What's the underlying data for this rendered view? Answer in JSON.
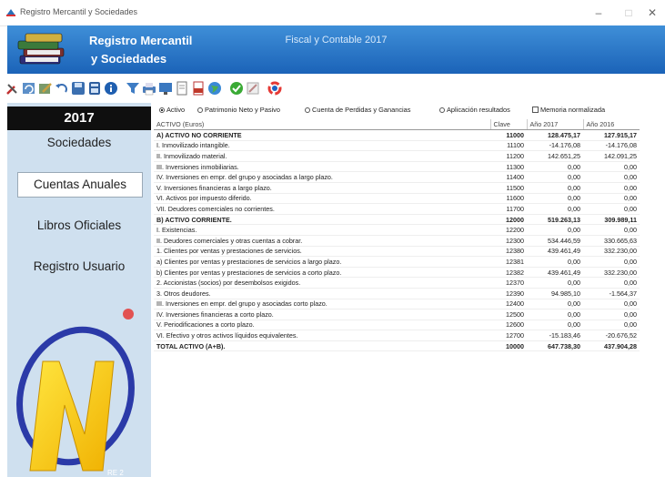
{
  "window": {
    "title": "Registro Mercantil y Sociedades",
    "min": "–",
    "max": "□",
    "close": "✕"
  },
  "banner": {
    "line1": "Registro Mercantil",
    "line2": "y Sociedades",
    "subtitle": "Fiscal y Contable 2017"
  },
  "toolbar": {
    "icons": [
      "tools-icon",
      "refresh-icon",
      "edit-icon",
      "undo-icon",
      "disk-icon",
      "calculator-icon",
      "info-icon",
      "funnel-icon",
      "print-icon",
      "monitor-icon",
      "document-icon",
      "pdf-icon",
      "globe-icon",
      "check-icon",
      "pencil-icon",
      "color-icon"
    ]
  },
  "sidebar": {
    "year": "2017",
    "items": [
      {
        "label": "Sociedades"
      },
      {
        "label": "Cuentas Anuales"
      },
      {
        "label": "Libros Oficiales"
      },
      {
        "label": "Registro Usuario"
      }
    ],
    "footer": "RE 2"
  },
  "options": {
    "activo": "Activo",
    "patrimonio": "Patrimonio Neto y Pasivo",
    "perdidas": "Cuenta de Perdidas y Ganancias",
    "aplicacion": "Aplicación resultados",
    "memoria": "Memoria normalizada"
  },
  "table": {
    "headers": [
      "ACTIVO (Euros)",
      "Clave",
      "Año 2017",
      "Año 2016"
    ],
    "rows": [
      {
        "label": "A) ACTIVO NO CORRIENTE",
        "clave": "11000",
        "y2017": "128.475,17",
        "y2016": "127.915,17",
        "bold": true
      },
      {
        "label": "I. Inmovilizado intangible.",
        "clave": "11100",
        "y2017": "-14.176,08",
        "y2016": "-14.176,08"
      },
      {
        "label": "II. Inmovilizado material.",
        "clave": "11200",
        "y2017": "142.651,25",
        "y2016": "142.091,25"
      },
      {
        "label": "III. Inversiones inmobiliarias.",
        "clave": "11300",
        "y2017": "0,00",
        "y2016": "0,00"
      },
      {
        "label": "IV. Inversiones en empr. del grupo y asociadas a largo plazo.",
        "clave": "11400",
        "y2017": "0,00",
        "y2016": "0,00"
      },
      {
        "label": "V. Inversiones financieras a largo plazo.",
        "clave": "11500",
        "y2017": "0,00",
        "y2016": "0,00"
      },
      {
        "label": "VI. Activos por impuesto diferido.",
        "clave": "11600",
        "y2017": "0,00",
        "y2016": "0,00"
      },
      {
        "label": "VII. Deudores comerciales no corrientes.",
        "clave": "11700",
        "y2017": "0,00",
        "y2016": "0,00"
      },
      {
        "label": "B) ACTIVO CORRIENTE.",
        "clave": "12000",
        "y2017": "519.263,13",
        "y2016": "309.989,11",
        "bold": true
      },
      {
        "label": "I. Existencias.",
        "clave": "12200",
        "y2017": "0,00",
        "y2016": "0,00"
      },
      {
        "label": "II. Deudores comerciales y otras cuentas a cobrar.",
        "clave": "12300",
        "y2017": "534.446,59",
        "y2016": "330.665,63"
      },
      {
        "label": "1. Clientes por ventas y prestaciones de servicios.",
        "clave": "12380",
        "y2017": "439.461,49",
        "y2016": "332.230,00"
      },
      {
        "label": "a) Clientes por ventas y prestaciones de servicios a largo plazo.",
        "clave": "12381",
        "y2017": "0,00",
        "y2016": "0,00"
      },
      {
        "label": "b) Clientes por ventas y prestaciones de servicios a corto plazo.",
        "clave": "12382",
        "y2017": "439.461,49",
        "y2016": "332.230,00"
      },
      {
        "label": "2. Accionistas (socios) por desembolsos exigidos.",
        "clave": "12370",
        "y2017": "0,00",
        "y2016": "0,00"
      },
      {
        "label": "3. Otros deudores.",
        "clave": "12390",
        "y2017": "94.985,10",
        "y2016": "-1.564,37"
      },
      {
        "label": "III. Inversiones en empr. del grupo y asociadas corto plazo.",
        "clave": "12400",
        "y2017": "0,00",
        "y2016": "0,00"
      },
      {
        "label": "IV. Inversiones financieras a corto plazo.",
        "clave": "12500",
        "y2017": "0,00",
        "y2016": "0,00"
      },
      {
        "label": "V. Periodificaciones a corto plazo.",
        "clave": "12600",
        "y2017": "0,00",
        "y2016": "0,00"
      },
      {
        "label": "VI. Efectivo y otros activos líquidos equivalentes.",
        "clave": "12700",
        "y2017": "-15.183,46",
        "y2016": "-20.676,52"
      },
      {
        "label": "TOTAL ACTIVO (A+B).",
        "clave": "10000",
        "y2017": "647.738,30",
        "y2016": "437.904,28",
        "bold": true,
        "total": true
      }
    ]
  }
}
